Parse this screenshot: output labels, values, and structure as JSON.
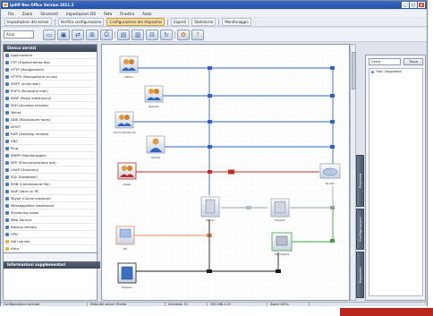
{
  "window": {
    "title": "ipdiff Neo Office Version 2011.2",
    "min_label": "_",
    "max_label": "□",
    "close_label": "x"
  },
  "menu": [
    "File",
    "Zoom",
    "Strumenti",
    "Impostazioni ISS",
    "Rete",
    "Finestra",
    "Aiuto"
  ],
  "toolbar": {
    "items": [
      "Impostazioni del server",
      "Verifica configurazione",
      "Configurazione dei dispositivi",
      "Esporti",
      "Statistiche",
      "Monitoraggio"
    ],
    "active_index": 2
  },
  "toolbar2": {
    "combo_value": "Arial",
    "icons": [
      "folder-open-icon",
      "save-icon",
      "connect-icon",
      "network-icon",
      "print-icon",
      "monitor-icon",
      "window-icon",
      "grid-icon",
      "refresh-icon",
      "settings-icon",
      "help-icon"
    ]
  },
  "sidebar": {
    "header": "Elenco servizi",
    "items": [
      "Applicazione",
      "FTP (Trasferimento file)",
      "HTTP (Navigazione)",
      "HTTPS (Navigazione sicura)",
      "SMTP (Invio mail)",
      "POP3 (Ricezione mail)",
      "IMAP (Posta elettronica)",
      "SSH (Accesso remoto)",
      "Telnet",
      "DNS (Risoluzione nomi)",
      "DHCP",
      "RDP (Desktop remoto)",
      "VNC",
      "Ping",
      "SNMP (Monitoraggio)",
      "NTP (Sincronizzazione ora)",
      "LDAP (Directory)",
      "SQL (Database)",
      "SMB (Condivisione file)",
      "VoIP (Voce su IP)",
      "Skype (Comunicazione)",
      "Messaggistica istantanea",
      "Streaming video",
      "Web Service",
      "Backup remoto",
      "VPN",
      "Altri servizi",
      "Altro"
    ],
    "folder_indices": [
      26,
      27
    ],
    "info_header": "Informazioni supplementari"
  },
  "diagram": {
    "nodes": [
      {
        "label": "Ufficio",
        "kind": "users"
      },
      {
        "label": "Reparto",
        "kind": "users"
      },
      {
        "label": "Amministrazione",
        "kind": "users"
      },
      {
        "label": "Utente",
        "kind": "user"
      },
      {
        "label": "Ospiti",
        "kind": "users-red"
      },
      {
        "label": "Router",
        "kind": "cloud"
      },
      {
        "label": "Server",
        "kind": "server"
      },
      {
        "label": "Firewall",
        "kind": "server"
      },
      {
        "label": "Stampante",
        "kind": "printer"
      },
      {
        "label": "PC",
        "kind": "pc"
      },
      {
        "label": "Telefono",
        "kind": "phone"
      }
    ]
  },
  "right_tabs": [
    "Proprietà",
    "Configurazione",
    "Dispositivi"
  ],
  "right_panel": {
    "search_placeholder": "Cerca",
    "button_label": "Trova",
    "items": [
      "Tutti i dispositivi"
    ]
  },
  "statusbar": [
    "Configurazione caricata",
    "Stato del server: Pronto",
    "Connessi: 12",
    "192.168.1.10",
    "Zoom 100%"
  ],
  "colors": {
    "blue_line": "#2f64c4",
    "red_line": "#c42a20",
    "orange_line": "#e08a52",
    "green_line": "#3aa23a",
    "black_line": "#1c1c1c",
    "gray_line": "#9aa0aa"
  }
}
